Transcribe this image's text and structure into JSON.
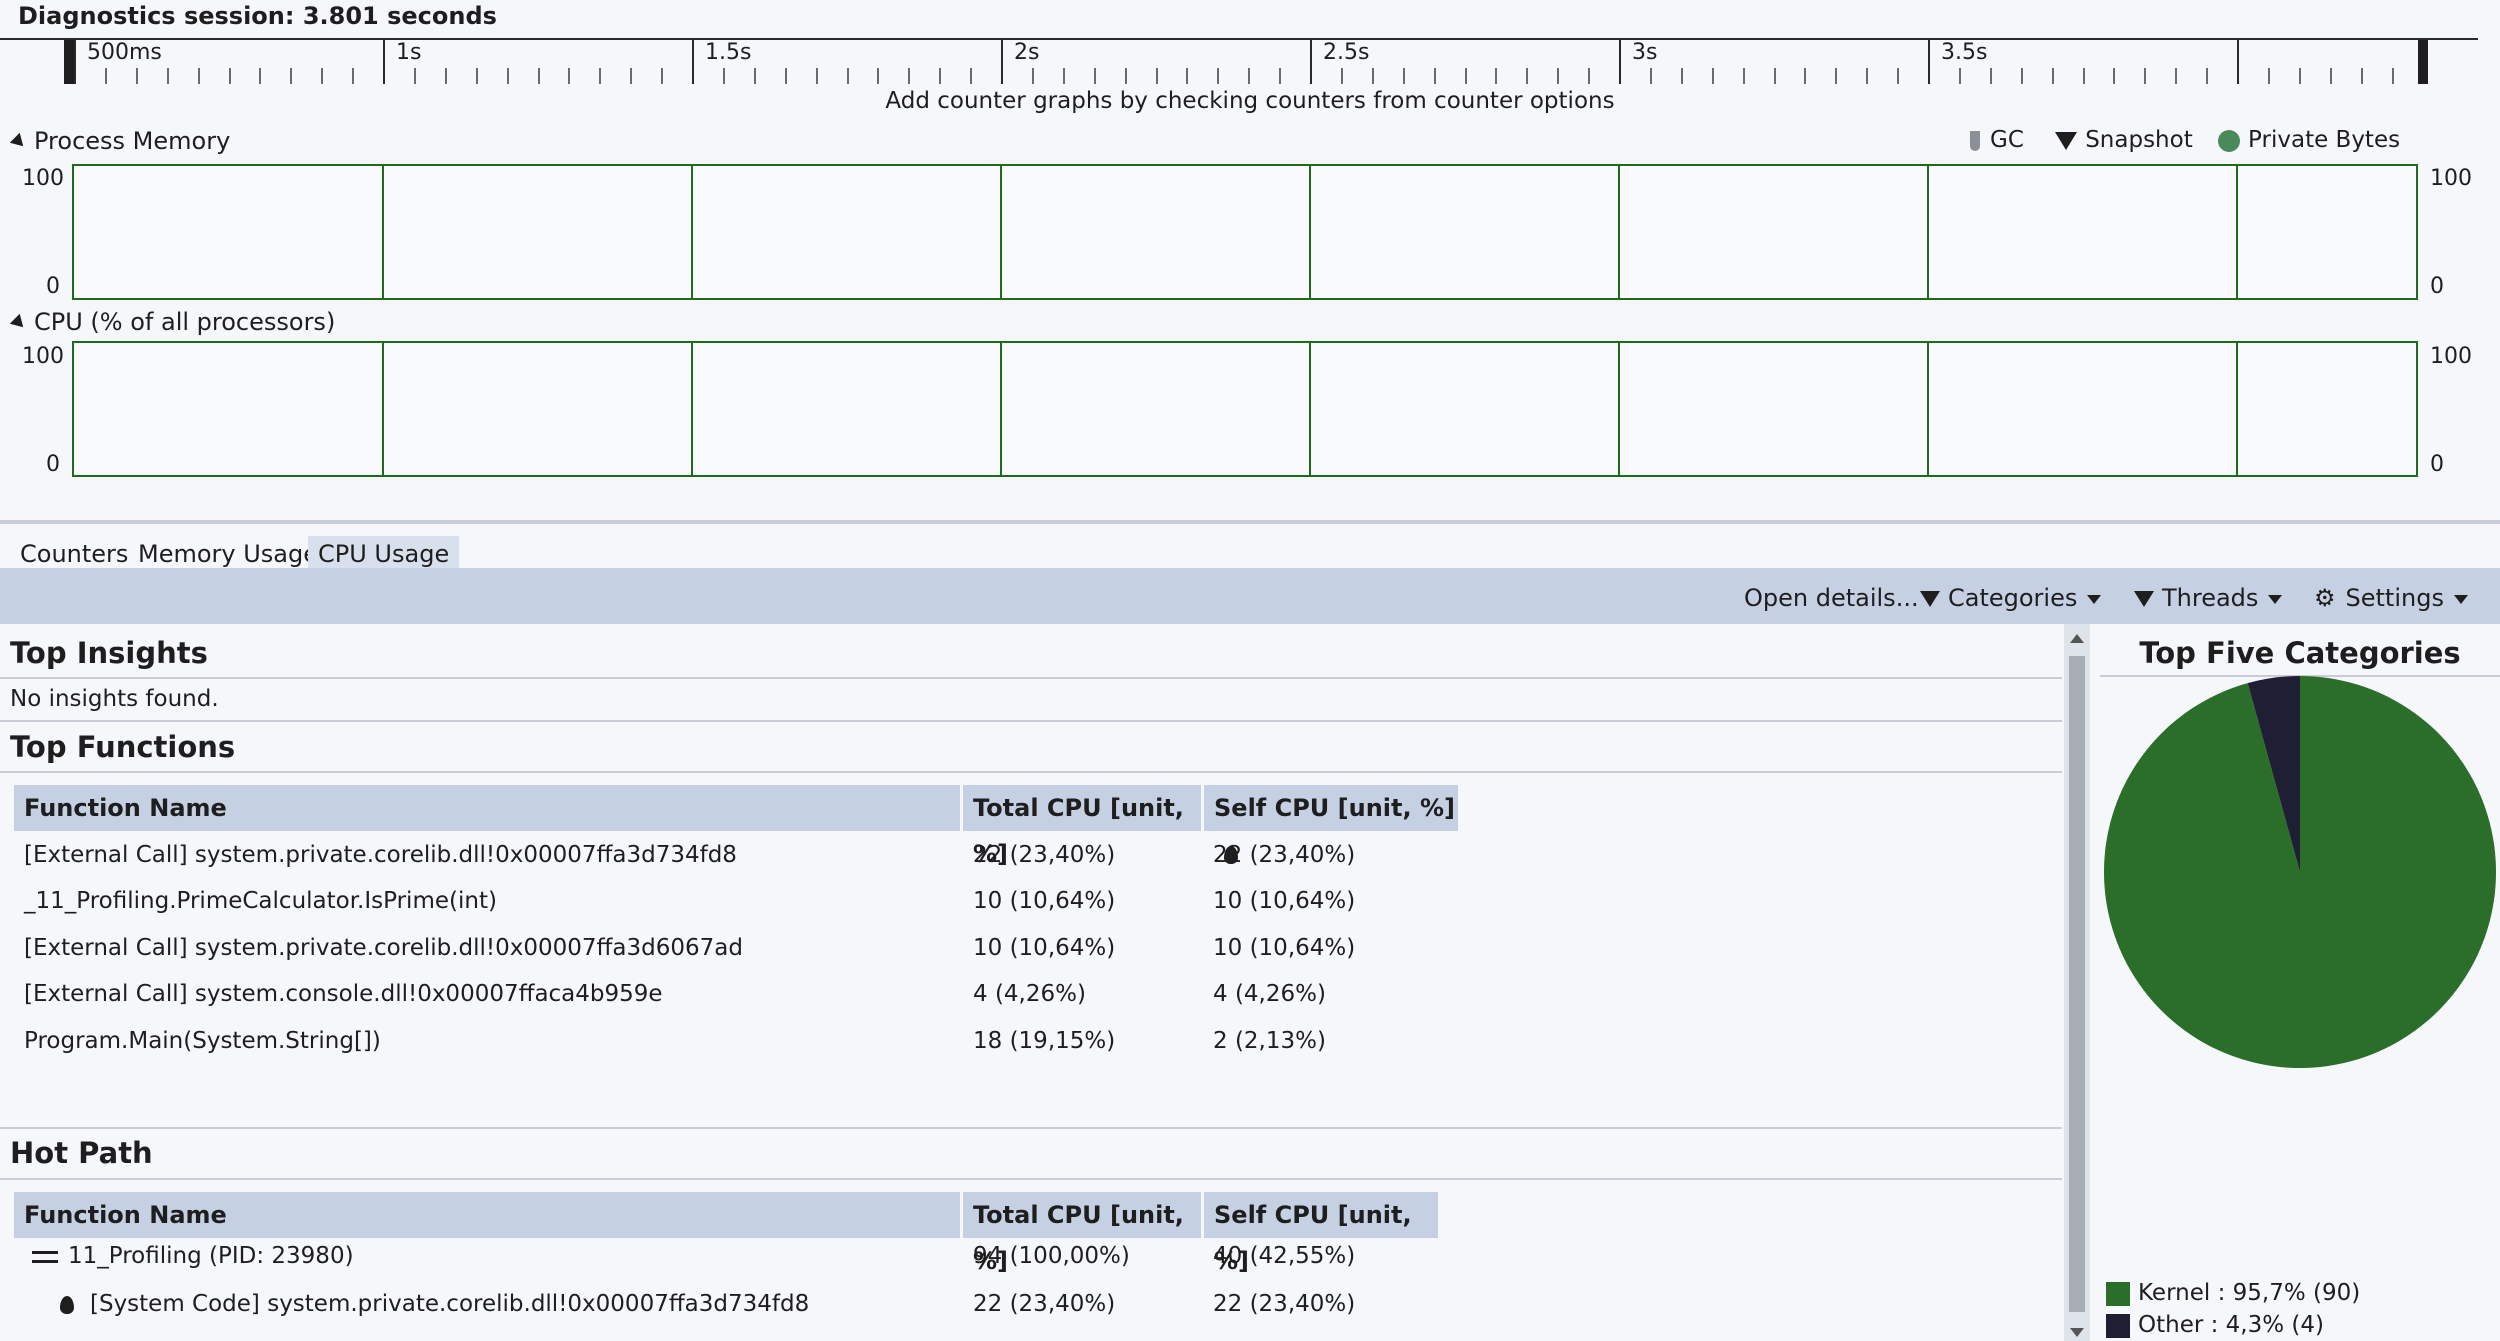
{
  "session": {
    "title": "Diagnostics session: 3.801 seconds"
  },
  "ruler": {
    "labels": [
      "500ms",
      "1s",
      "1.5s",
      "2s",
      "2.5s",
      "3s",
      "3.5s"
    ]
  },
  "counter_hint": "Add counter graphs by checking counters from counter options",
  "process_memory": {
    "title": "Process Memory",
    "axis_max": "100",
    "axis_min": "0",
    "legend": {
      "gc": "GC",
      "snapshot": "Snapshot",
      "private_bytes": "Private Bytes"
    }
  },
  "cpu_graph": {
    "title": "CPU (% of all processors)",
    "axis_max": "100",
    "axis_min": "0"
  },
  "tabs": [
    {
      "label": "Counters",
      "active": false
    },
    {
      "label": "Memory Usage",
      "active": false
    },
    {
      "label": "CPU Usage",
      "active": true
    }
  ],
  "toolbar": {
    "open_details": "Open details...",
    "categories": "Categories",
    "threads": "Threads",
    "settings": "Settings"
  },
  "top_insights": {
    "title": "Top Insights",
    "message": "No insights found."
  },
  "top_functions": {
    "title": "Top Functions",
    "columns": [
      "Function Name",
      "Total CPU [unit, %]",
      "Self CPU [unit, %]"
    ],
    "rows": [
      {
        "name": "[External Call] system.private.corelib.dll!0x00007ffa3d734fd8",
        "total": "22 (23,40%)",
        "self": "22 (23,40%)"
      },
      {
        "name": "_11_Profiling.PrimeCalculator.IsPrime(int)",
        "total": "10 (10,64%)",
        "self": "10 (10,64%)"
      },
      {
        "name": "[External Call] system.private.corelib.dll!0x00007ffa3d6067ad",
        "total": "10 (10,64%)",
        "self": "10 (10,64%)"
      },
      {
        "name": "[External Call] system.console.dll!0x00007ffaca4b959e",
        "total": "4 (4,26%)",
        "self": "4 (4,26%)"
      },
      {
        "name": "Program.Main(System.String[])",
        "total": "18 (19,15%)",
        "self": "2 (2,13%)"
      }
    ]
  },
  "hot_path": {
    "title": "Hot Path",
    "columns": [
      "Function Name",
      "Total CPU [unit, %]",
      "Self CPU [unit, %]"
    ],
    "rows": [
      {
        "name": "11_Profiling (PID: 23980)",
        "total": "94 (100,00%)",
        "self": "40 (42,55%)"
      },
      {
        "name": "[System Code] system.private.corelib.dll!0x00007ffa3d734fd8",
        "total": "22 (23,40%)",
        "self": "22 (23,40%)"
      }
    ]
  },
  "top_categories": {
    "title": "Top Five Categories",
    "slices": [
      {
        "label": "Kernel : 95,7% (90)",
        "value": 95.7,
        "color": "#2a6e2a"
      },
      {
        "label": "Other : 4,3% (4)",
        "value": 4.3,
        "color": "#1f1f33"
      }
    ]
  }
}
